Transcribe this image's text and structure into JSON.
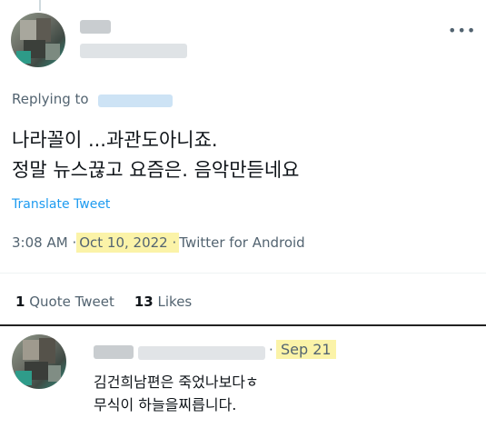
{
  "tweet": {
    "author_name": "",
    "author_handle": "",
    "more_icon": "more-horizontal-icon",
    "replying_label": "Replying to",
    "text_line1": "나라꼴이 ...과관도아니죠.",
    "text_line2": "정말 뉴스끊고 요즘은. 음악만듣네요",
    "translate_label": "Translate Tweet",
    "time": "3:08 AM",
    "separator": "·",
    "date": "Oct 10, 2022 ·",
    "source": "Twitter for Android",
    "quote_count": "1",
    "quote_label": "Quote Tweet",
    "like_count": "13",
    "like_label": "Likes"
  },
  "reply": {
    "separator": "·",
    "date": "Sep 21",
    "text_line1": "김건희남편은 죽었나보다ㅎ",
    "text_line2": "무식이 하늘을찌릅니다."
  },
  "colors": {
    "highlight": "#fbf3a8",
    "link": "#1d9bf0",
    "muted": "#536471"
  }
}
